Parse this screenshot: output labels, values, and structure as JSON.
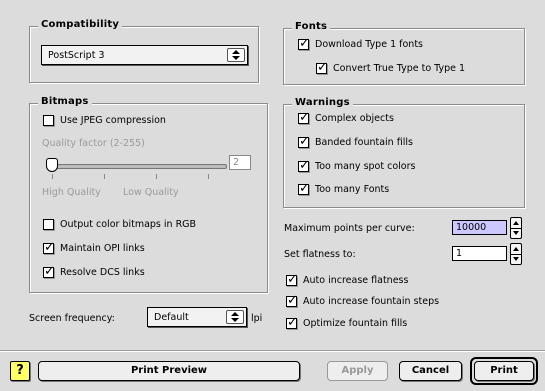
{
  "compatibility": {
    "title": "Compatibility",
    "selected": "PostScript 3"
  },
  "fonts": {
    "title": "Fonts",
    "download_type1": "Download Type 1 fonts",
    "convert_truetype": "Convert True Type to Type 1"
  },
  "bitmaps": {
    "title": "Bitmaps",
    "use_jpeg": "Use JPEG compression",
    "quality_label": "Quality factor (2-255)",
    "quality_value": "2",
    "slider_fraction": 0.0,
    "high_quality": "High Quality",
    "low_quality": "Low Quality",
    "output_rgb": "Output color bitmaps in RGB",
    "maintain_opi": "Maintain OPI links",
    "resolve_dcs": "Resolve DCS links"
  },
  "warnings": {
    "title": "Warnings",
    "complex_objects": "Complex objects",
    "banded_fills": "Banded fountain fills",
    "spot_colors": "Too many spot colors",
    "many_fonts": "Too many Fonts"
  },
  "curve": {
    "max_points_label": "Maximum points per curve:",
    "max_points_value": "10000",
    "flatness_label": "Set flatness to:",
    "flatness_value": "1"
  },
  "options": {
    "auto_flatness": "Auto increase flatness",
    "auto_fountain": "Auto increase fountain steps",
    "optimize_fills": "Optimize fountain fills"
  },
  "screen": {
    "label": "Screen frequency:",
    "selected": "Default",
    "unit": "lpi"
  },
  "buttons": {
    "help": "?",
    "preview": "Print Preview",
    "apply": "Apply",
    "cancel": "Cancel",
    "print": "Print"
  }
}
